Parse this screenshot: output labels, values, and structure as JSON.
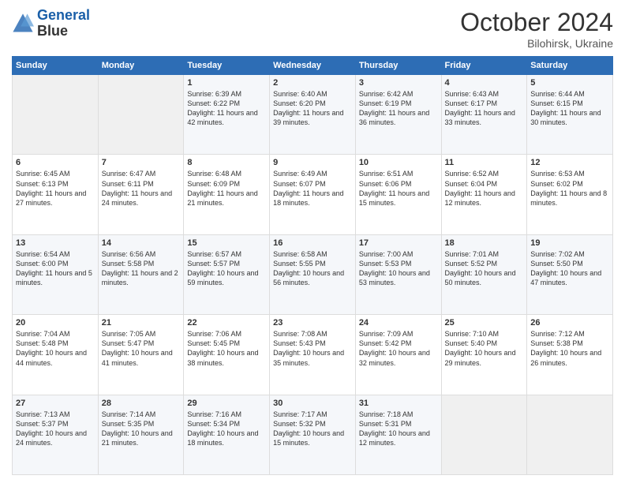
{
  "header": {
    "logo_line1": "General",
    "logo_line2": "Blue",
    "month_title": "October 2024",
    "location": "Bilohirsk, Ukraine"
  },
  "weekdays": [
    "Sunday",
    "Monday",
    "Tuesday",
    "Wednesday",
    "Thursday",
    "Friday",
    "Saturday"
  ],
  "weeks": [
    [
      {
        "day": "",
        "empty": true
      },
      {
        "day": "",
        "empty": true
      },
      {
        "day": "1",
        "sunrise": "6:39 AM",
        "sunset": "6:22 PM",
        "daylight": "11 hours and 42 minutes."
      },
      {
        "day": "2",
        "sunrise": "6:40 AM",
        "sunset": "6:20 PM",
        "daylight": "11 hours and 39 minutes."
      },
      {
        "day": "3",
        "sunrise": "6:42 AM",
        "sunset": "6:19 PM",
        "daylight": "11 hours and 36 minutes."
      },
      {
        "day": "4",
        "sunrise": "6:43 AM",
        "sunset": "6:17 PM",
        "daylight": "11 hours and 33 minutes."
      },
      {
        "day": "5",
        "sunrise": "6:44 AM",
        "sunset": "6:15 PM",
        "daylight": "11 hours and 30 minutes."
      }
    ],
    [
      {
        "day": "6",
        "sunrise": "6:45 AM",
        "sunset": "6:13 PM",
        "daylight": "11 hours and 27 minutes."
      },
      {
        "day": "7",
        "sunrise": "6:47 AM",
        "sunset": "6:11 PM",
        "daylight": "11 hours and 24 minutes."
      },
      {
        "day": "8",
        "sunrise": "6:48 AM",
        "sunset": "6:09 PM",
        "daylight": "11 hours and 21 minutes."
      },
      {
        "day": "9",
        "sunrise": "6:49 AM",
        "sunset": "6:07 PM",
        "daylight": "11 hours and 18 minutes."
      },
      {
        "day": "10",
        "sunrise": "6:51 AM",
        "sunset": "6:06 PM",
        "daylight": "11 hours and 15 minutes."
      },
      {
        "day": "11",
        "sunrise": "6:52 AM",
        "sunset": "6:04 PM",
        "daylight": "11 hours and 12 minutes."
      },
      {
        "day": "12",
        "sunrise": "6:53 AM",
        "sunset": "6:02 PM",
        "daylight": "11 hours and 8 minutes."
      }
    ],
    [
      {
        "day": "13",
        "sunrise": "6:54 AM",
        "sunset": "6:00 PM",
        "daylight": "11 hours and 5 minutes."
      },
      {
        "day": "14",
        "sunrise": "6:56 AM",
        "sunset": "5:58 PM",
        "daylight": "11 hours and 2 minutes."
      },
      {
        "day": "15",
        "sunrise": "6:57 AM",
        "sunset": "5:57 PM",
        "daylight": "10 hours and 59 minutes."
      },
      {
        "day": "16",
        "sunrise": "6:58 AM",
        "sunset": "5:55 PM",
        "daylight": "10 hours and 56 minutes."
      },
      {
        "day": "17",
        "sunrise": "7:00 AM",
        "sunset": "5:53 PM",
        "daylight": "10 hours and 53 minutes."
      },
      {
        "day": "18",
        "sunrise": "7:01 AM",
        "sunset": "5:52 PM",
        "daylight": "10 hours and 50 minutes."
      },
      {
        "day": "19",
        "sunrise": "7:02 AM",
        "sunset": "5:50 PM",
        "daylight": "10 hours and 47 minutes."
      }
    ],
    [
      {
        "day": "20",
        "sunrise": "7:04 AM",
        "sunset": "5:48 PM",
        "daylight": "10 hours and 44 minutes."
      },
      {
        "day": "21",
        "sunrise": "7:05 AM",
        "sunset": "5:47 PM",
        "daylight": "10 hours and 41 minutes."
      },
      {
        "day": "22",
        "sunrise": "7:06 AM",
        "sunset": "5:45 PM",
        "daylight": "10 hours and 38 minutes."
      },
      {
        "day": "23",
        "sunrise": "7:08 AM",
        "sunset": "5:43 PM",
        "daylight": "10 hours and 35 minutes."
      },
      {
        "day": "24",
        "sunrise": "7:09 AM",
        "sunset": "5:42 PM",
        "daylight": "10 hours and 32 minutes."
      },
      {
        "day": "25",
        "sunrise": "7:10 AM",
        "sunset": "5:40 PM",
        "daylight": "10 hours and 29 minutes."
      },
      {
        "day": "26",
        "sunrise": "7:12 AM",
        "sunset": "5:38 PM",
        "daylight": "10 hours and 26 minutes."
      }
    ],
    [
      {
        "day": "27",
        "sunrise": "7:13 AM",
        "sunset": "5:37 PM",
        "daylight": "10 hours and 24 minutes."
      },
      {
        "day": "28",
        "sunrise": "7:14 AM",
        "sunset": "5:35 PM",
        "daylight": "10 hours and 21 minutes."
      },
      {
        "day": "29",
        "sunrise": "7:16 AM",
        "sunset": "5:34 PM",
        "daylight": "10 hours and 18 minutes."
      },
      {
        "day": "30",
        "sunrise": "7:17 AM",
        "sunset": "5:32 PM",
        "daylight": "10 hours and 15 minutes."
      },
      {
        "day": "31",
        "sunrise": "7:18 AM",
        "sunset": "5:31 PM",
        "daylight": "10 hours and 12 minutes."
      },
      {
        "day": "",
        "empty": true
      },
      {
        "day": "",
        "empty": true
      }
    ]
  ]
}
